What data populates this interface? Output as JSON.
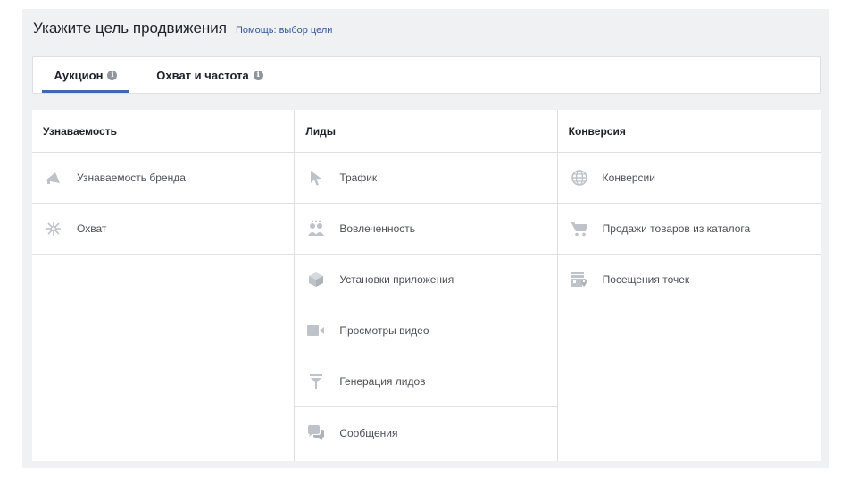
{
  "header": {
    "title": "Укажите цель продвижения",
    "help_link": "Помощь: выбор цели"
  },
  "tabs": [
    {
      "label": "Аукцион",
      "active": true
    },
    {
      "label": "Охват и частота",
      "active": false
    }
  ],
  "columns": [
    {
      "title": "Узнаваемость",
      "items": [
        {
          "label": "Узнаваемость бренда",
          "icon": "megaphone-icon"
        },
        {
          "label": "Охват",
          "icon": "reach-icon"
        }
      ]
    },
    {
      "title": "Лиды",
      "items": [
        {
          "label": "Трафик",
          "icon": "cursor-icon"
        },
        {
          "label": "Вовлеченность",
          "icon": "people-icon"
        },
        {
          "label": "Установки приложения",
          "icon": "box-icon"
        },
        {
          "label": "Просмотры видео",
          "icon": "video-camera-icon"
        },
        {
          "label": "Генерация лидов",
          "icon": "funnel-icon"
        },
        {
          "label": "Сообщения",
          "icon": "chat-bubbles-icon"
        }
      ]
    },
    {
      "title": "Конверсия",
      "items": [
        {
          "label": "Конверсии",
          "icon": "globe-icon"
        },
        {
          "label": "Продажи товаров из каталога",
          "icon": "cart-icon"
        },
        {
          "label": "Посещения точек",
          "icon": "store-icon"
        }
      ]
    }
  ],
  "colors": {
    "accent": "#4267b2",
    "link": "#365899",
    "icon": "#bec2c9",
    "panel_bg": "#f0f1f3",
    "border": "#dddfe2"
  }
}
